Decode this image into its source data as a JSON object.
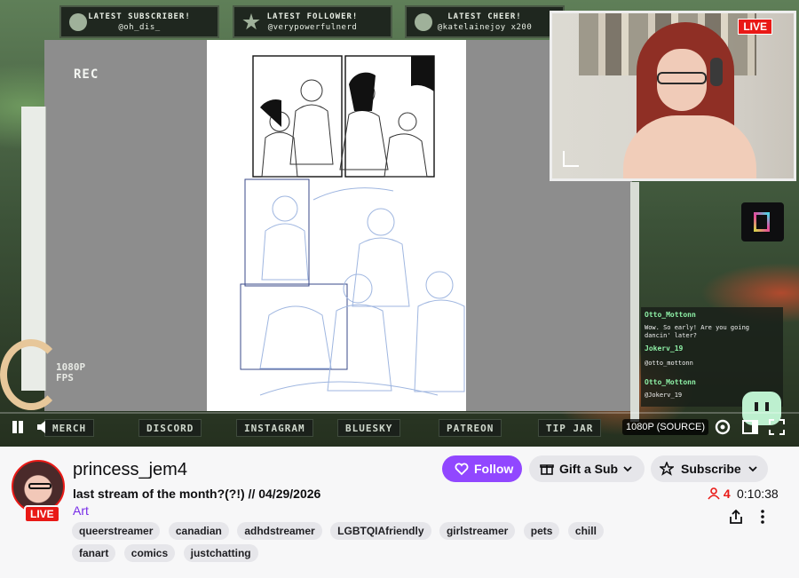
{
  "overlay": {
    "alerts": [
      {
        "title": "LATEST SUBSCRIBER!",
        "value": "@oh_dis_"
      },
      {
        "title": "LATEST FOLLOWER!",
        "value": "@verypowerfulnerd"
      },
      {
        "title": "LATEST CHEER!",
        "value": "@katelainejoy x200"
      }
    ],
    "rec_label": "REC",
    "fps_label": "1080P\nFPS",
    "webcam_live": "LIVE",
    "links": [
      "MERCH",
      "DISCORD",
      "INSTAGRAM",
      "BLUESKY",
      "PATREON",
      "TIP JAR"
    ]
  },
  "chat": [
    {
      "name": "Otto_Mottonn",
      "text": "Wow. So early! Are you going dancin' later?"
    },
    {
      "name": "Jokerv_19",
      "text": "@otto_mottonn"
    },
    {
      "name": "Otto_Mottonn",
      "text": "@Jokerv_19"
    }
  ],
  "player": {
    "quality": "1080P (SOURCE)"
  },
  "channel": {
    "name": "princess_jem4",
    "live_badge": "LIVE",
    "title": "last stream of the month?(?!) // 04/29/2026",
    "category": "Art",
    "tags": [
      "queerstreamer",
      "canadian",
      "adhdstreamer",
      "LGBTQIAfriendly",
      "girlstreamer",
      "pets",
      "chill",
      "fanart",
      "comics",
      "justchatting"
    ],
    "viewers": "4",
    "uptime": "0:10:38"
  },
  "actions": {
    "follow": "Follow",
    "gift": "Gift a Sub",
    "subscribe": "Subscribe"
  },
  "colors": {
    "accent": "#9147ff",
    "live": "#e91916",
    "category": "#772ce8"
  }
}
